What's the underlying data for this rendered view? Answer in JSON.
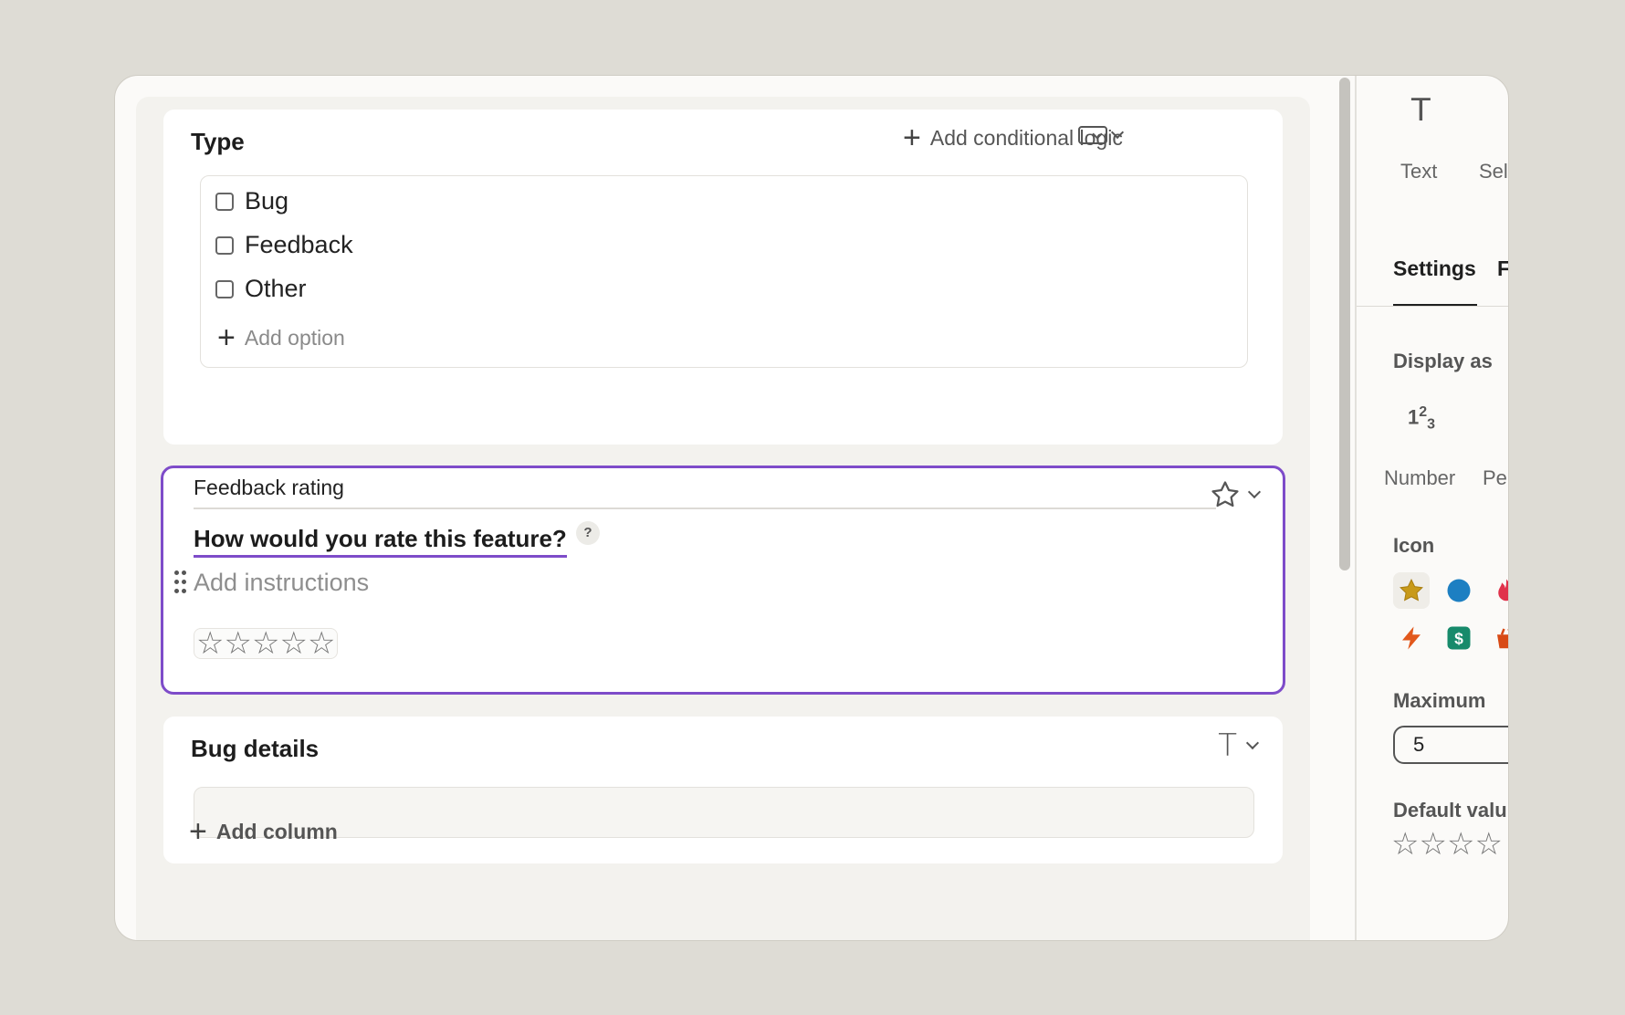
{
  "colors": {
    "accent": "#7e4cc9",
    "star_gold": "#c89a1a",
    "blue": "#1d7fc2",
    "red": "#e0324b",
    "orange": "#e2581c",
    "green": "#178a6b",
    "orange2": "#d84a15"
  },
  "type_card": {
    "title": "Type",
    "add_logic": "Add conditional logic",
    "field_type_icon": "dropdown-icon",
    "options": [
      "Bug",
      "Feedback",
      "Other"
    ],
    "add_option": "Add option"
  },
  "rating_card": {
    "label": "Feedback rating",
    "question": "How would you rate this feature?",
    "help": "?",
    "instructions_placeholder": "Add instructions",
    "field_type_icon": "star-icon",
    "max_stars": 5
  },
  "bug_card": {
    "title": "Bug details",
    "field_type_icon": "text-type-icon"
  },
  "add_column": "Add column",
  "panel": {
    "type_icon": "T",
    "type_labels": [
      "Text",
      "Sel"
    ],
    "tabs": [
      "Settings",
      "F"
    ],
    "display_as_heading": "Display as",
    "number_glyph": "123",
    "display_labels": [
      "Number",
      "Pe"
    ],
    "icon_heading": "Icon",
    "maximum_heading": "Maximum",
    "maximum_value": "5",
    "default_heading": "Default valu"
  }
}
